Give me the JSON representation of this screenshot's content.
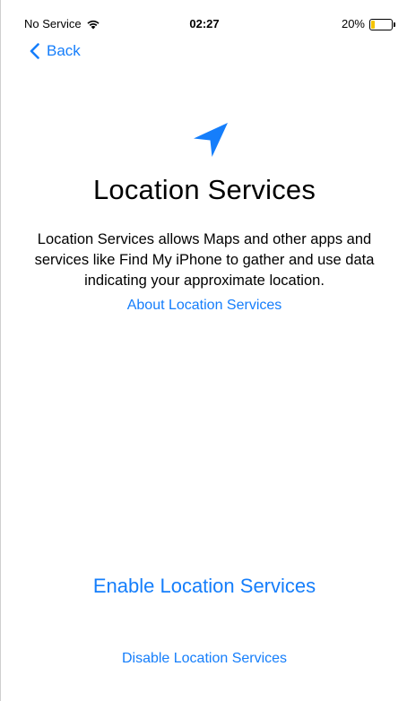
{
  "status_bar": {
    "carrier": "No Service",
    "time": "02:27",
    "battery_percent": "20%",
    "battery_level": 0.2,
    "battery_color": "#f5c400"
  },
  "nav": {
    "back_label": "Back"
  },
  "icons": {
    "wifi": "wifi-icon",
    "back": "chevron-left-icon",
    "hero": "location-arrow-icon",
    "battery": "battery-icon"
  },
  "main": {
    "title": "Location Services",
    "description": "Location Services allows Maps and other apps and services like Find My iPhone to gather and use data indicating your approximate location.",
    "about_link": "About Location Services",
    "enable_button": "Enable Location Services",
    "disable_button": "Disable Location Services"
  },
  "colors": {
    "accent": "#157efb",
    "background": "#ffffff",
    "text": "#000000"
  }
}
